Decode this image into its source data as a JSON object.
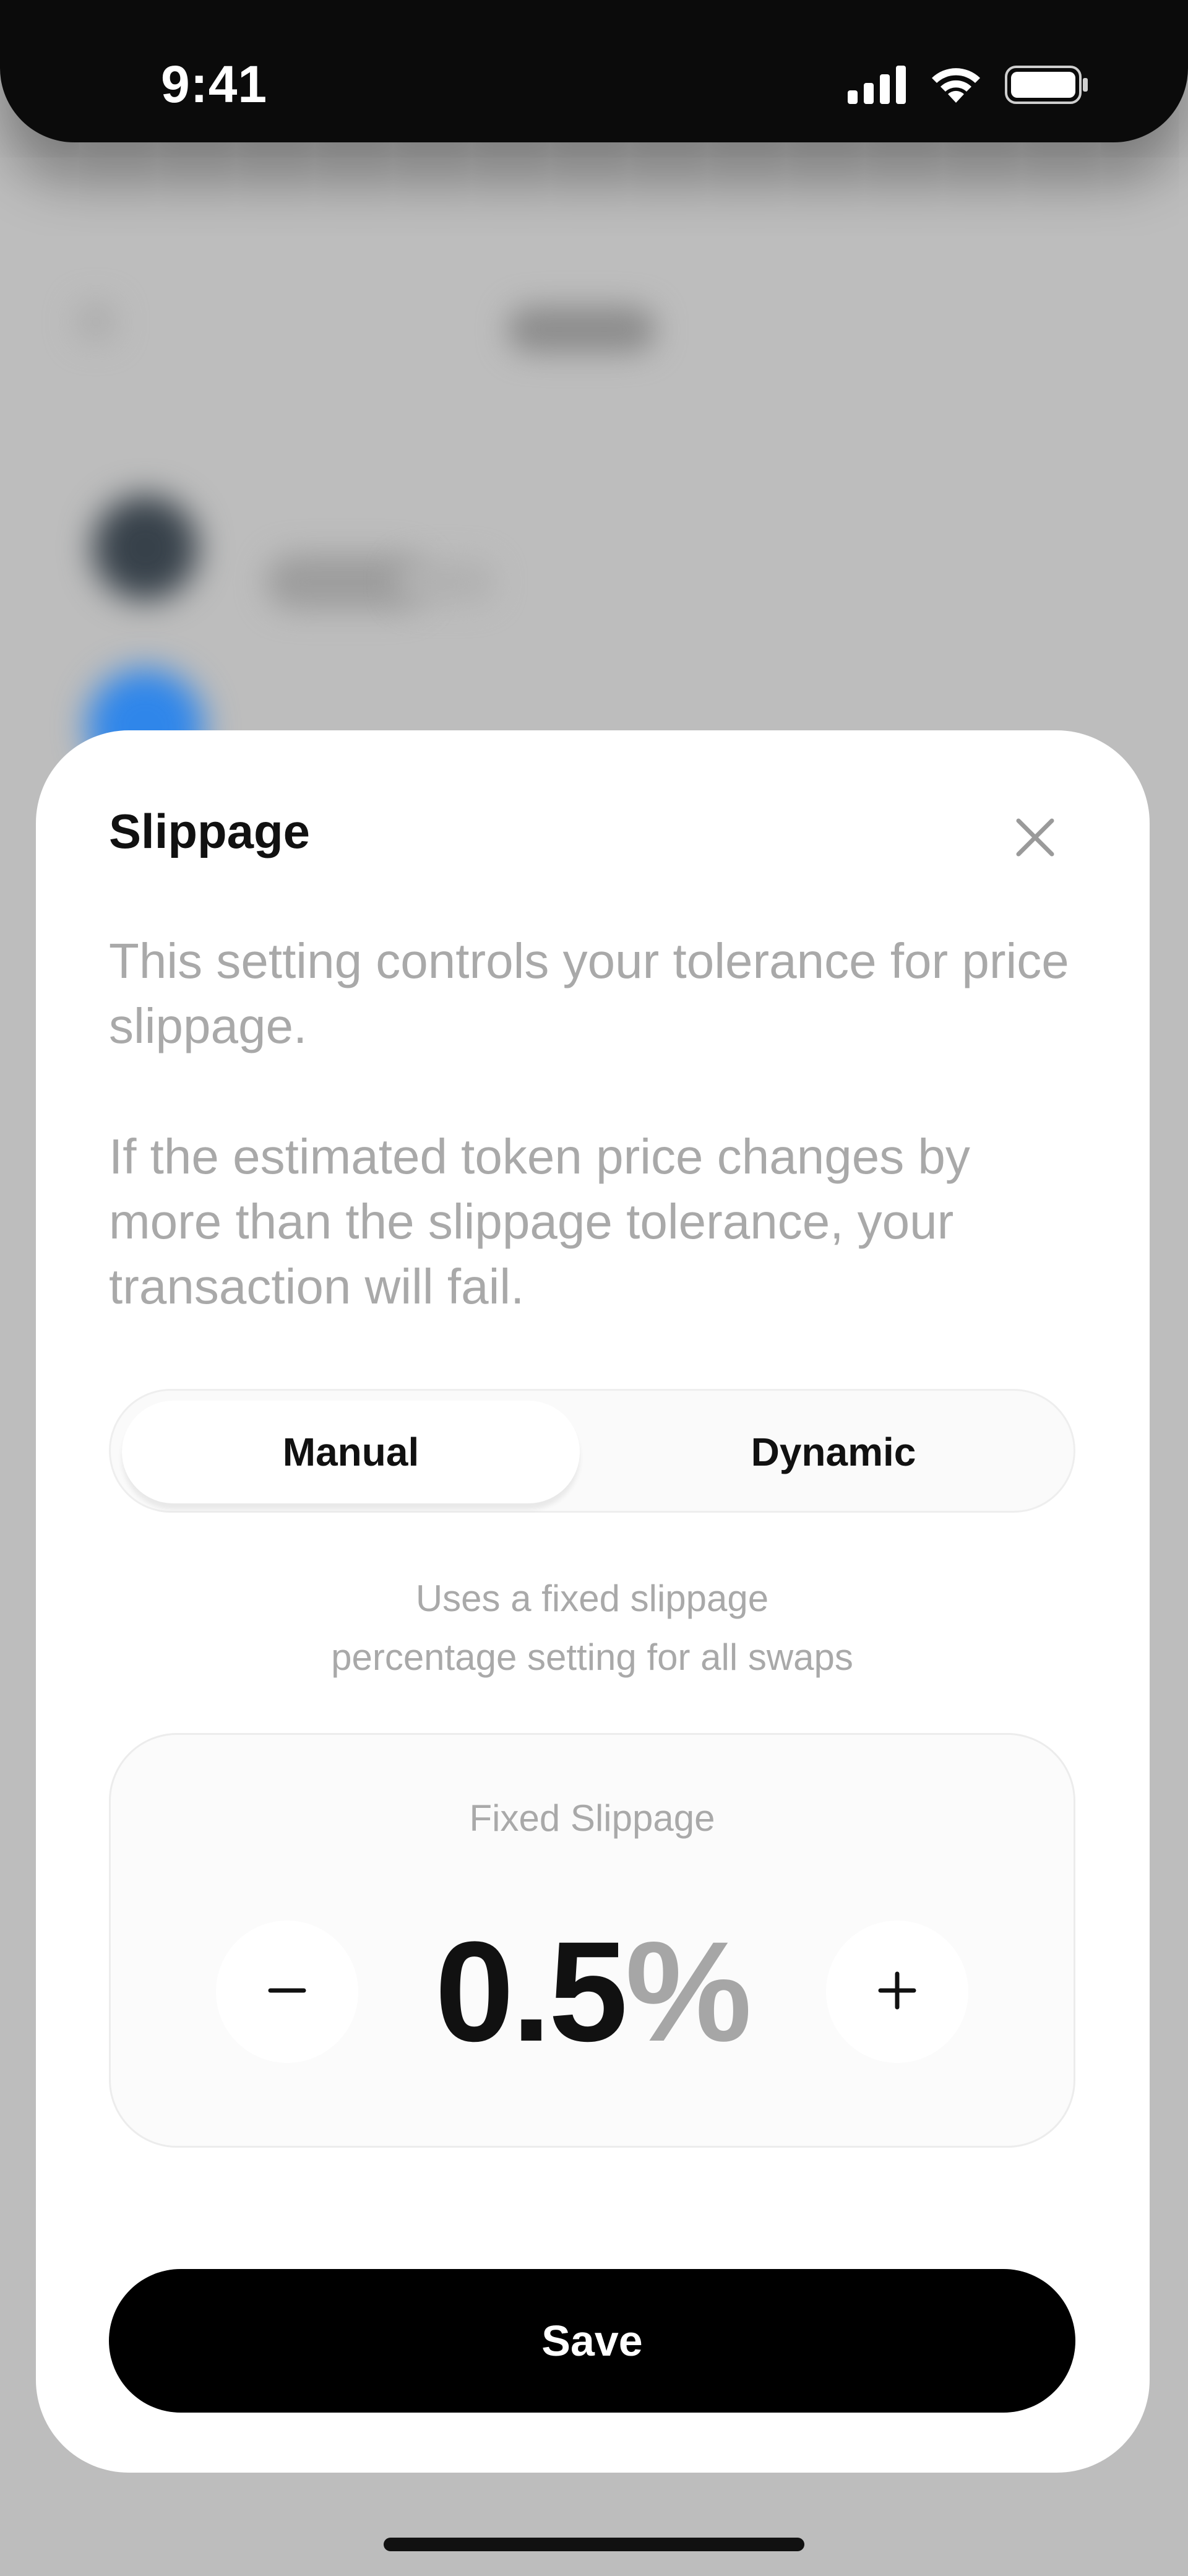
{
  "status_bar": {
    "time": "9:41",
    "icons": [
      "cellular-signal-icon",
      "wifi-icon",
      "battery-icon"
    ]
  },
  "sheet": {
    "title": "Slippage",
    "close_icon": "close-icon",
    "description_1": "This setting controls your tolerance for price slippage.",
    "description_2": "If the estimated token price changes by more than the slippage tolerance, your transaction will fail.",
    "segmented": {
      "options": [
        {
          "label": "Manual",
          "active": true
        },
        {
          "label": "Dynamic",
          "active": false
        }
      ]
    },
    "hint_line_1": "Uses a fixed slippage",
    "hint_line_2": "percentage setting for all swaps",
    "fixed_slippage": {
      "label": "Fixed Slippage",
      "value": "0.5",
      "unit": "%",
      "decrement_icon": "minus-icon",
      "increment_icon": "plus-icon"
    },
    "save_label": "Save"
  },
  "colors": {
    "backdrop": "#bdbdbd",
    "sheet": "#ffffff",
    "primary_text": "#111111",
    "secondary_text": "#a9a9a9",
    "save_button": "#000000"
  }
}
